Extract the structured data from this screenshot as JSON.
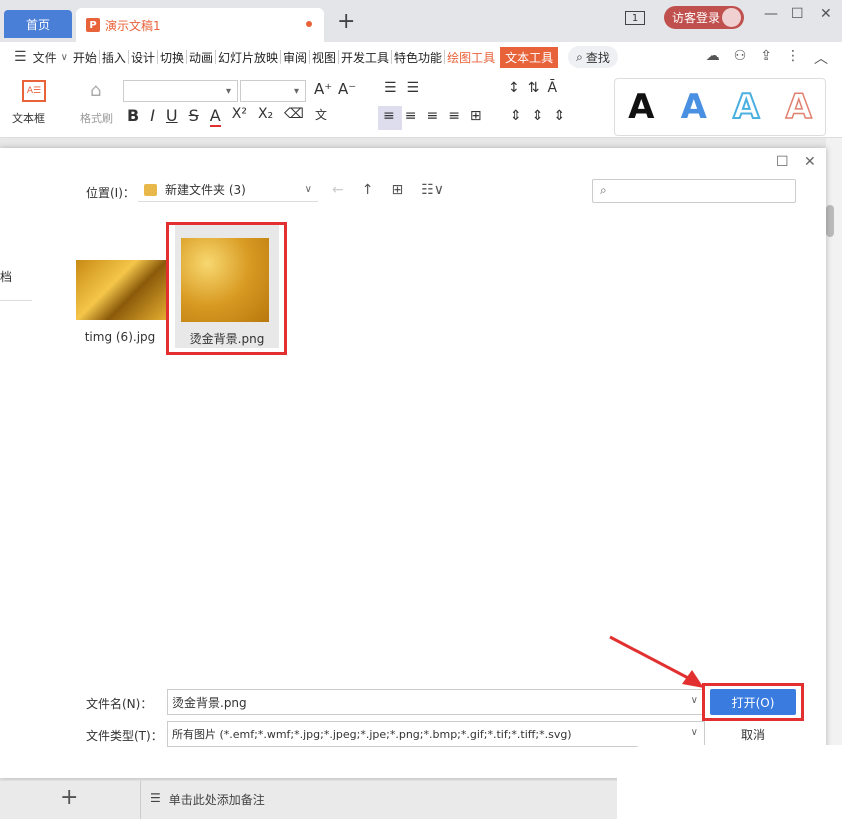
{
  "titlebar": {
    "home_tab": "首页",
    "doc_tab": "演示文稿1",
    "doc_icon_letter": "P",
    "new_tab": "+",
    "page_badge": "1",
    "visitor_login": "访客登录",
    "minimize": "—",
    "maximize": "☐",
    "close": "✕"
  },
  "menubar": {
    "file": "文件",
    "items": [
      "开始",
      "插入",
      "设计",
      "切换",
      "动画",
      "幻灯片放映",
      "审阅",
      "视图",
      "开发工具",
      "特色功能"
    ],
    "draw_tools": "绘图工具",
    "text_tools": "文本工具",
    "search": "查找"
  },
  "ribbon": {
    "textbox_label": "文本框",
    "format_painter": "格式刷",
    "bold": "B",
    "italic": "I",
    "underline": "U",
    "strike": "S",
    "font_color": "A",
    "superscript": "X²",
    "subscript": "X₂",
    "style_letters": [
      "A",
      "A",
      "A",
      "A"
    ]
  },
  "dialog": {
    "side_text": "档",
    "location_label": "位置(I)：",
    "location_value": "新建文件夹 (3)",
    "files": [
      {
        "name": "timg (6).jpg"
      },
      {
        "name": "烫金背景.png"
      }
    ],
    "filename_label": "文件名(N)：",
    "filename_value": "烫金背景.png",
    "filetype_label": "文件类型(T)：",
    "filetype_value": "所有图片 (*.emf;*.wmf;*.jpg;*.jpeg;*.jpe;*.png;*.bmp;*.gif;*.tif;*.tiff;*.svg)",
    "open_button": "打开(O)",
    "cancel_button": "取消"
  },
  "bottom": {
    "add": "+",
    "notes_placeholder": "单击此处添加备注"
  },
  "colors": {
    "accent": "#e8623a",
    "primary_blue": "#3a7be0",
    "highlight_red": "#e23030"
  }
}
